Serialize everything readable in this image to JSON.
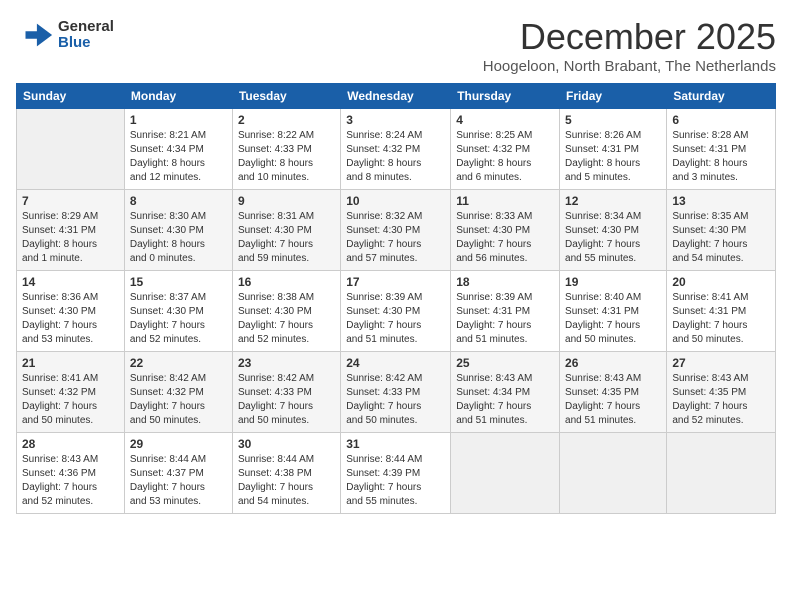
{
  "logo": {
    "general": "General",
    "blue": "Blue"
  },
  "header": {
    "month": "December 2025",
    "location": "Hoogeloon, North Brabant, The Netherlands"
  },
  "days_of_week": [
    "Sunday",
    "Monday",
    "Tuesday",
    "Wednesday",
    "Thursday",
    "Friday",
    "Saturday"
  ],
  "weeks": [
    [
      {
        "day": "",
        "info": ""
      },
      {
        "day": "1",
        "info": "Sunrise: 8:21 AM\nSunset: 4:34 PM\nDaylight: 8 hours\nand 12 minutes."
      },
      {
        "day": "2",
        "info": "Sunrise: 8:22 AM\nSunset: 4:33 PM\nDaylight: 8 hours\nand 10 minutes."
      },
      {
        "day": "3",
        "info": "Sunrise: 8:24 AM\nSunset: 4:32 PM\nDaylight: 8 hours\nand 8 minutes."
      },
      {
        "day": "4",
        "info": "Sunrise: 8:25 AM\nSunset: 4:32 PM\nDaylight: 8 hours\nand 6 minutes."
      },
      {
        "day": "5",
        "info": "Sunrise: 8:26 AM\nSunset: 4:31 PM\nDaylight: 8 hours\nand 5 minutes."
      },
      {
        "day": "6",
        "info": "Sunrise: 8:28 AM\nSunset: 4:31 PM\nDaylight: 8 hours\nand 3 minutes."
      }
    ],
    [
      {
        "day": "7",
        "info": "Sunrise: 8:29 AM\nSunset: 4:31 PM\nDaylight: 8 hours\nand 1 minute."
      },
      {
        "day": "8",
        "info": "Sunrise: 8:30 AM\nSunset: 4:30 PM\nDaylight: 8 hours\nand 0 minutes."
      },
      {
        "day": "9",
        "info": "Sunrise: 8:31 AM\nSunset: 4:30 PM\nDaylight: 7 hours\nand 59 minutes."
      },
      {
        "day": "10",
        "info": "Sunrise: 8:32 AM\nSunset: 4:30 PM\nDaylight: 7 hours\nand 57 minutes."
      },
      {
        "day": "11",
        "info": "Sunrise: 8:33 AM\nSunset: 4:30 PM\nDaylight: 7 hours\nand 56 minutes."
      },
      {
        "day": "12",
        "info": "Sunrise: 8:34 AM\nSunset: 4:30 PM\nDaylight: 7 hours\nand 55 minutes."
      },
      {
        "day": "13",
        "info": "Sunrise: 8:35 AM\nSunset: 4:30 PM\nDaylight: 7 hours\nand 54 minutes."
      }
    ],
    [
      {
        "day": "14",
        "info": "Sunrise: 8:36 AM\nSunset: 4:30 PM\nDaylight: 7 hours\nand 53 minutes."
      },
      {
        "day": "15",
        "info": "Sunrise: 8:37 AM\nSunset: 4:30 PM\nDaylight: 7 hours\nand 52 minutes."
      },
      {
        "day": "16",
        "info": "Sunrise: 8:38 AM\nSunset: 4:30 PM\nDaylight: 7 hours\nand 52 minutes."
      },
      {
        "day": "17",
        "info": "Sunrise: 8:39 AM\nSunset: 4:30 PM\nDaylight: 7 hours\nand 51 minutes."
      },
      {
        "day": "18",
        "info": "Sunrise: 8:39 AM\nSunset: 4:31 PM\nDaylight: 7 hours\nand 51 minutes."
      },
      {
        "day": "19",
        "info": "Sunrise: 8:40 AM\nSunset: 4:31 PM\nDaylight: 7 hours\nand 50 minutes."
      },
      {
        "day": "20",
        "info": "Sunrise: 8:41 AM\nSunset: 4:31 PM\nDaylight: 7 hours\nand 50 minutes."
      }
    ],
    [
      {
        "day": "21",
        "info": "Sunrise: 8:41 AM\nSunset: 4:32 PM\nDaylight: 7 hours\nand 50 minutes."
      },
      {
        "day": "22",
        "info": "Sunrise: 8:42 AM\nSunset: 4:32 PM\nDaylight: 7 hours\nand 50 minutes."
      },
      {
        "day": "23",
        "info": "Sunrise: 8:42 AM\nSunset: 4:33 PM\nDaylight: 7 hours\nand 50 minutes."
      },
      {
        "day": "24",
        "info": "Sunrise: 8:42 AM\nSunset: 4:33 PM\nDaylight: 7 hours\nand 50 minutes."
      },
      {
        "day": "25",
        "info": "Sunrise: 8:43 AM\nSunset: 4:34 PM\nDaylight: 7 hours\nand 51 minutes."
      },
      {
        "day": "26",
        "info": "Sunrise: 8:43 AM\nSunset: 4:35 PM\nDaylight: 7 hours\nand 51 minutes."
      },
      {
        "day": "27",
        "info": "Sunrise: 8:43 AM\nSunset: 4:35 PM\nDaylight: 7 hours\nand 52 minutes."
      }
    ],
    [
      {
        "day": "28",
        "info": "Sunrise: 8:43 AM\nSunset: 4:36 PM\nDaylight: 7 hours\nand 52 minutes."
      },
      {
        "day": "29",
        "info": "Sunrise: 8:44 AM\nSunset: 4:37 PM\nDaylight: 7 hours\nand 53 minutes."
      },
      {
        "day": "30",
        "info": "Sunrise: 8:44 AM\nSunset: 4:38 PM\nDaylight: 7 hours\nand 54 minutes."
      },
      {
        "day": "31",
        "info": "Sunrise: 8:44 AM\nSunset: 4:39 PM\nDaylight: 7 hours\nand 55 minutes."
      },
      {
        "day": "",
        "info": ""
      },
      {
        "day": "",
        "info": ""
      },
      {
        "day": "",
        "info": ""
      }
    ]
  ]
}
